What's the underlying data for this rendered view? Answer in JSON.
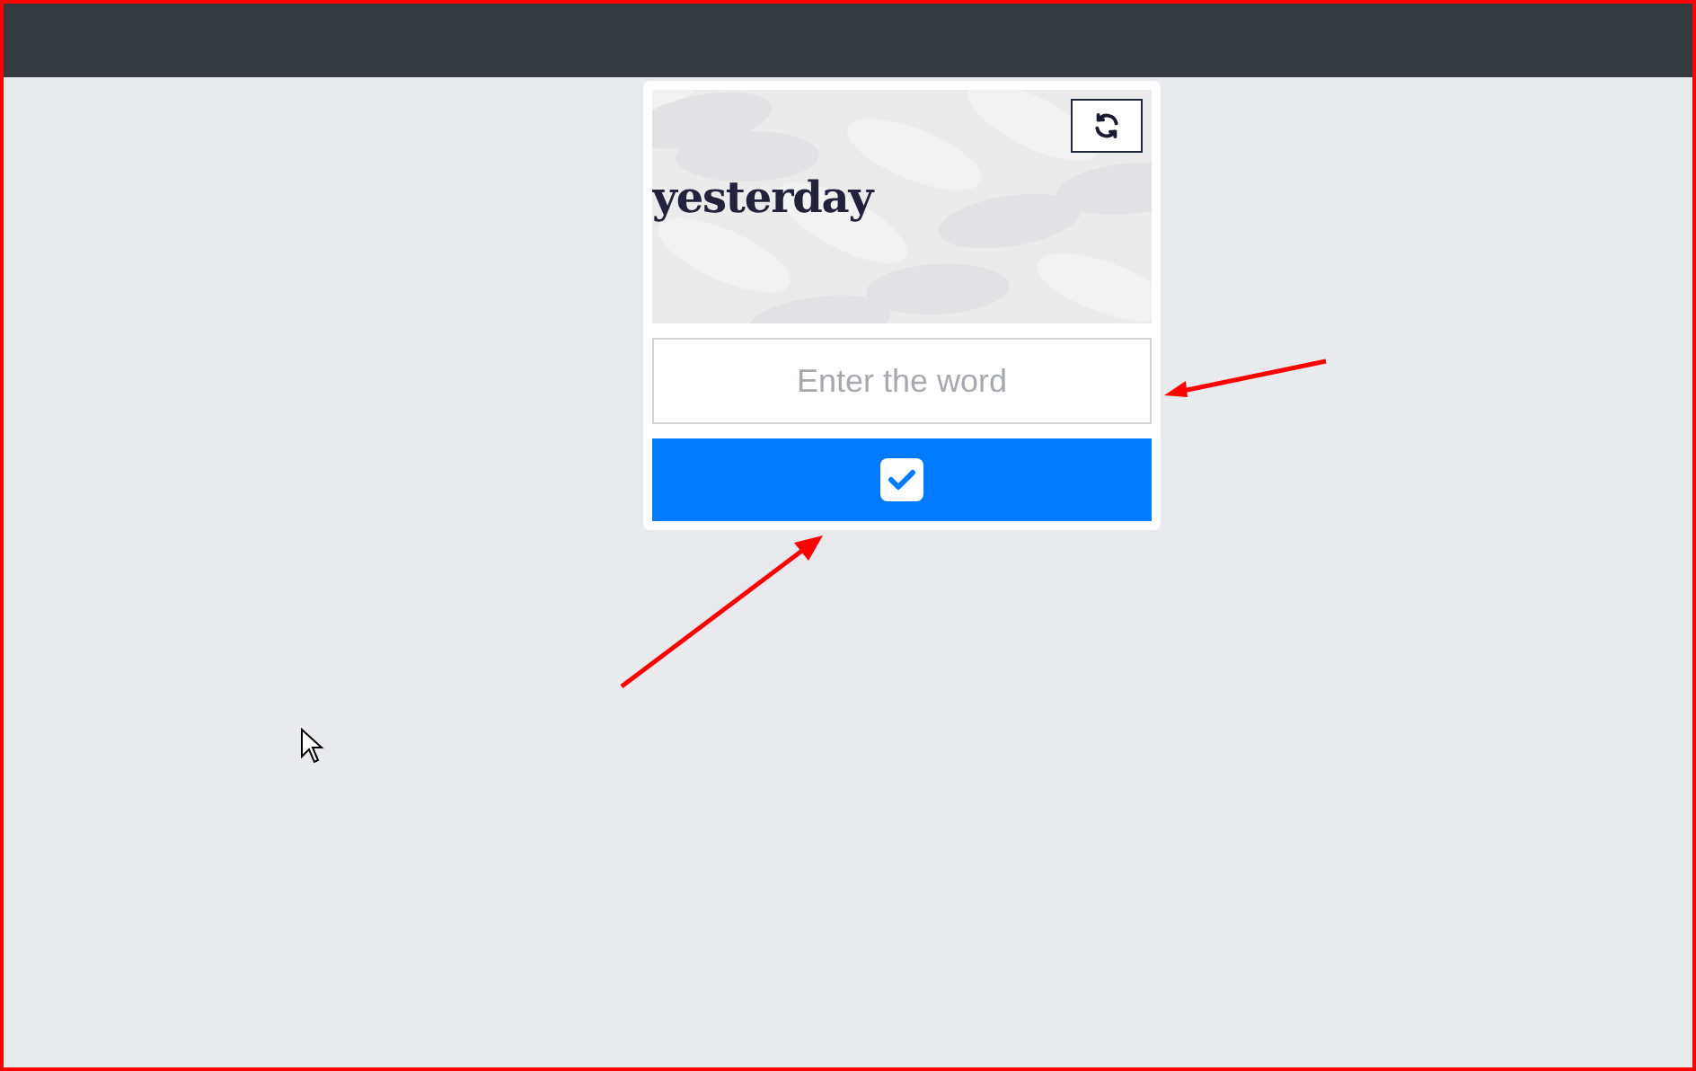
{
  "captcha": {
    "word": "yesterday"
  },
  "answer": {
    "placeholder": "Enter the word"
  }
}
